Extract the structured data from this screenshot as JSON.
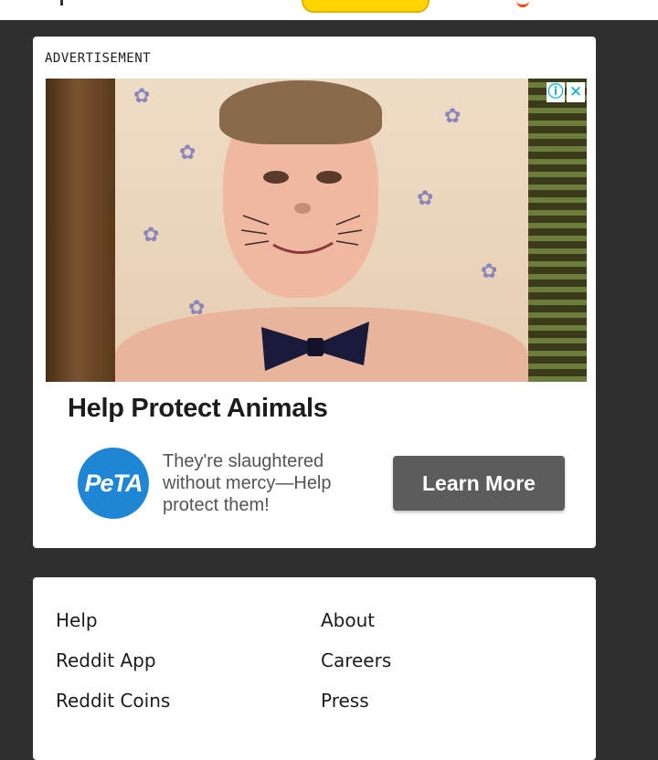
{
  "ad": {
    "label": "ADVERTISEMENT",
    "headline": "Help Protect Animals",
    "advertiser_logo_text": "PeTA",
    "body": "They're slaughtered without mercy—Help protect them!",
    "cta": "Learn More",
    "info_icon": "ⓘ",
    "close_icon": "✕"
  },
  "footer": {
    "left_links": [
      "Help",
      "Reddit App",
      "Reddit Coins"
    ],
    "right_links": [
      "About",
      "Careers",
      "Press"
    ]
  },
  "colors": {
    "page_background": "#2f2f2f",
    "card_background": "#ffffff",
    "cta_background": "#5c5c5c",
    "peta_blue": "#1f86d6",
    "adchoices_cyan": "#00aecd"
  }
}
